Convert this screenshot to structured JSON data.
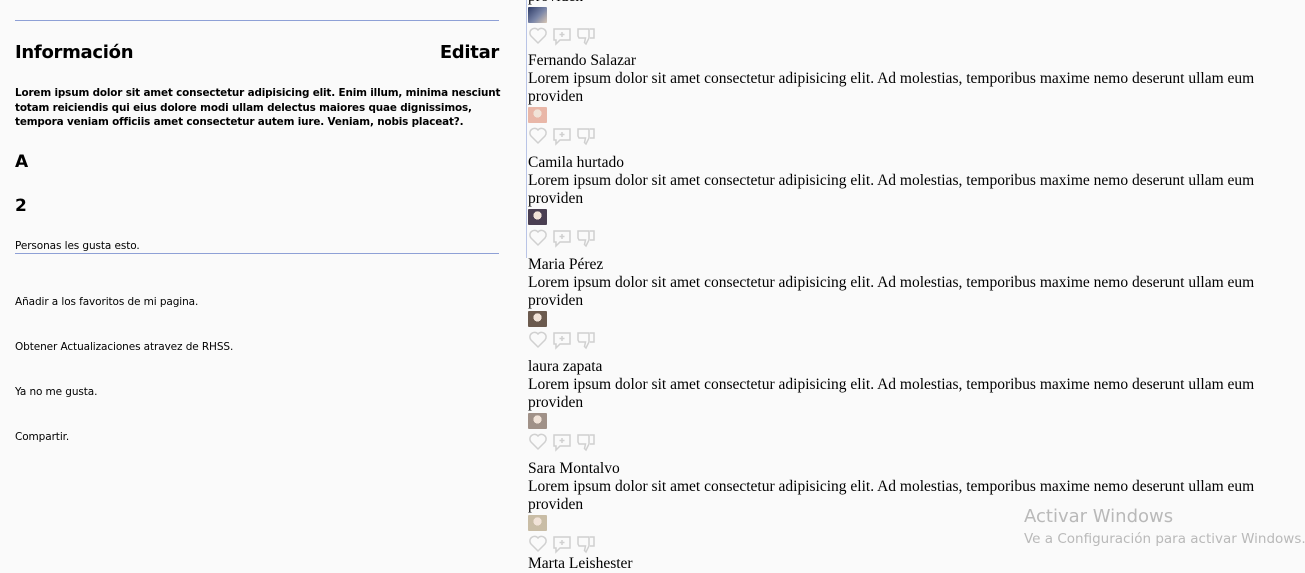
{
  "info_panel": {
    "title": "Información",
    "edit_label": "Editar",
    "description": "Lorem ipsum dolor sit amet consectetur adipisicing elit. Enim illum, minima nesciunt totam reiciendis qui eius dolore modi ullam delectus maiores quae dignissimos, tempora veniam officiis amet consectetur autem iure. Veniam, nobis placeat?.",
    "big_a": "A",
    "likes_count": "2",
    "likes_text": "Personas les gusta esto.",
    "actions": [
      "Añadir a los favoritos de mi pagina.",
      "Obtener Actualizaciones atravez de RHSS.",
      "Ya no me gusta.",
      "Compartir."
    ]
  },
  "feed": {
    "partial_top_text": "providen",
    "posts": [
      {
        "name": "Fernando Salazar",
        "text": "Lorem ipsum dolor sit amet consectetur adipisicing elit. Ad molestias, temporibus maxime nemo deserunt ullam eum providen",
        "avatar_color": "#e9b7a8"
      },
      {
        "name": "Camila hurtado",
        "text": "Lorem ipsum dolor sit amet consectetur adipisicing elit. Ad molestias, temporibus maxime nemo deserunt ullam eum providen",
        "avatar_color": "#4a3f52"
      },
      {
        "name": "Maria Pérez",
        "text": "Lorem ipsum dolor sit amet consectetur adipisicing elit. Ad molestias, temporibus maxime nemo deserunt ullam eum providen",
        "avatar_color": "#6b5a4e"
      },
      {
        "name": "laura zapata",
        "text": "Lorem ipsum dolor sit amet consectetur adipisicing elit. Ad molestias, temporibus maxime nemo deserunt ullam eum providen",
        "avatar_color": "#a09188"
      },
      {
        "name": "Sara Montalvo",
        "text": "Lorem ipsum dolor sit amet consectetur adipisicing elit. Ad molestias, temporibus maxime nemo deserunt ullam eum providen",
        "avatar_color": "#c9bda6"
      }
    ],
    "partial_bottom_name": "Marta Leishester"
  },
  "watermark": {
    "title": "Activar Windows",
    "subtitle": "Ve a Configuración para activar Windows."
  }
}
